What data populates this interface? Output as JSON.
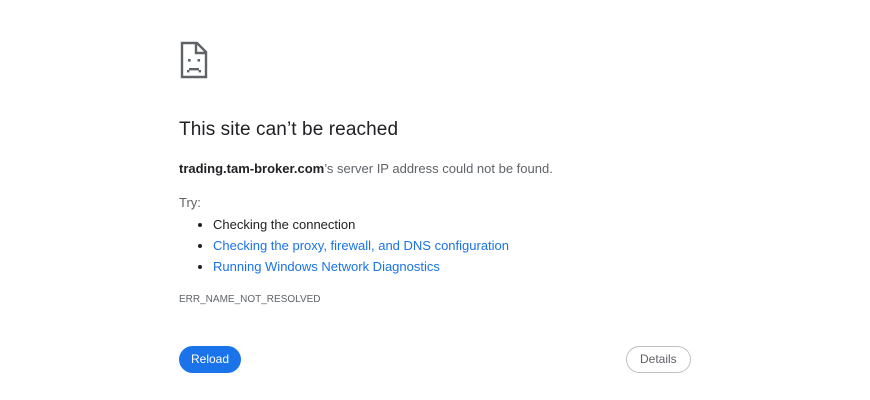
{
  "icon": "sad-page-icon",
  "title": "This site can’t be reached",
  "summary": {
    "host": "trading.tam-broker.com",
    "message": "’s server IP address could not be found."
  },
  "try_label": "Try:",
  "suggestions": [
    {
      "label": "Checking the connection",
      "is_link": false
    },
    {
      "label": "Checking the proxy, firewall, and DNS configuration",
      "is_link": true
    },
    {
      "label": "Running Windows Network Diagnostics",
      "is_link": true
    }
  ],
  "error_code": "ERR_NAME_NOT_RESOLVED",
  "buttons": {
    "reload_label": "Reload",
    "details_label": "Details"
  },
  "colors": {
    "accent": "#1a73e8",
    "text": "#202124",
    "secondary_text": "#5f6368"
  }
}
